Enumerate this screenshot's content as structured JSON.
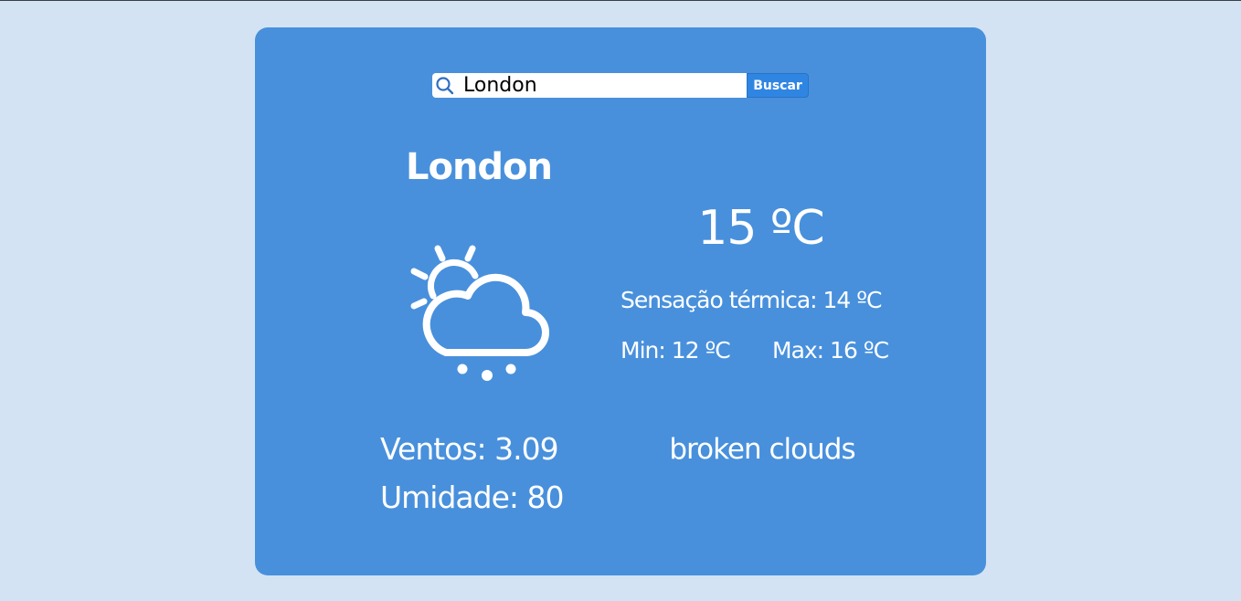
{
  "search": {
    "value": "London",
    "button_label": "Buscar",
    "icon": "search-icon"
  },
  "weather": {
    "city": "London",
    "icon": "partly-cloudy-rain-icon",
    "temperature": "15 ºC",
    "feels_like": "Sensação térmica: 14 ºC",
    "min": "Min: 12 ºC",
    "max": "Max: 16 ºC",
    "wind": "Ventos: 3.09",
    "humidity": "Umidade: 80",
    "description": "broken clouds"
  },
  "colors": {
    "background": "#d3e3f4",
    "card": "#4890dc",
    "button": "#2f86e2",
    "text": "#ffffff",
    "search_icon": "#2f6fc0"
  }
}
